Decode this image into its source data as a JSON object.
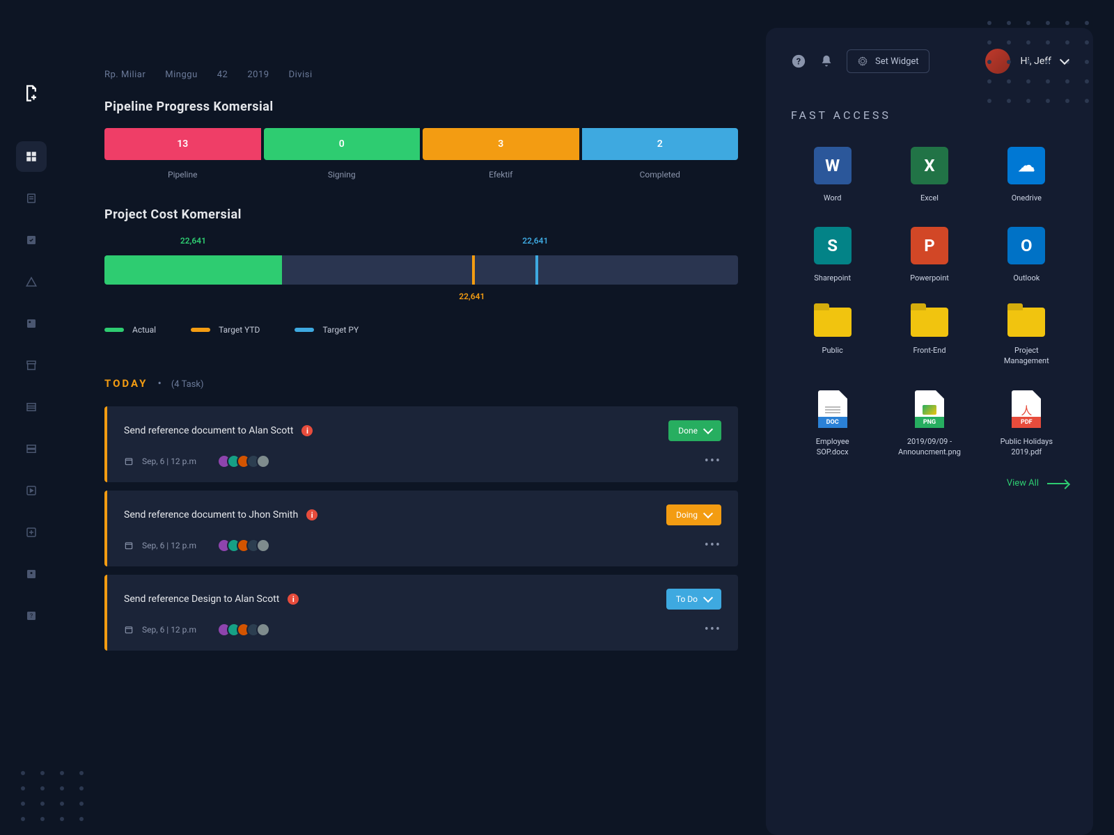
{
  "breadcrumb": [
    "Rp. Miliar",
    "Minggu",
    "42",
    "2019",
    "Divisi"
  ],
  "sections": {
    "pipeline_title": "Pipeline Progress Komersial",
    "cost_title": "Project Cost Komersial"
  },
  "pipeline": [
    {
      "value": "13",
      "label": "Pipeline",
      "color": "#ef3e67"
    },
    {
      "value": "0",
      "label": "Signing",
      "color": "#2ecc71"
    },
    {
      "value": "3",
      "label": "Efektif",
      "color": "#f39c12"
    },
    {
      "value": "2",
      "label": "Completed",
      "color": "#3ea9e0"
    }
  ],
  "chart_data": {
    "type": "bar",
    "title": "Project Cost Komersial",
    "actual": 22641,
    "target_ytd": 22641,
    "target_py": 22641,
    "actual_pct": 28,
    "ytd_marker_pct": 58,
    "py_marker_pct": 68,
    "legend": [
      {
        "name": "Actual",
        "color": "#2ecc71"
      },
      {
        "name": "Target YTD",
        "color": "#f39c12"
      },
      {
        "name": "Target PY",
        "color": "#3ea9e0"
      }
    ]
  },
  "cost_labels": {
    "top_actual": "22,641",
    "top_py": "22,641",
    "bottom_ytd": "22,641"
  },
  "today": {
    "title": "TODAY",
    "count": "(4 Task)"
  },
  "tasks": [
    {
      "title": "Send reference document to Alan Scott",
      "date": "Sep, 6  |  12 p.m",
      "status": "Done",
      "status_color": "#27ae60"
    },
    {
      "title": "Send reference document to Jhon Smith",
      "date": "Sep, 6  |  12 p.m",
      "status": "Doing",
      "status_color": "#f39c12"
    },
    {
      "title": "Send reference Design to Alan Scott",
      "date": "Sep, 6  |  12 p.m",
      "status": "To Do",
      "status_color": "#3ea9e0"
    }
  ],
  "right": {
    "set_widget": "Set Widget",
    "user_greeting": "Hi, Jeff",
    "fast_access_title": "FAST ACCESS",
    "view_all": "View All"
  },
  "fast_access": [
    {
      "label": "Word",
      "kind": "app",
      "bg": "#2b579a",
      "letter": "W"
    },
    {
      "label": "Excel",
      "kind": "app",
      "bg": "#217346",
      "letter": "X"
    },
    {
      "label": "Onedrive",
      "kind": "app",
      "bg": "#0078d4",
      "letter": "☁"
    },
    {
      "label": "Sharepoint",
      "kind": "app",
      "bg": "#038387",
      "letter": "S"
    },
    {
      "label": "Powerpoint",
      "kind": "app",
      "bg": "#d24726",
      "letter": "P"
    },
    {
      "label": "Outlook",
      "kind": "app",
      "bg": "#0072c6",
      "letter": "O"
    },
    {
      "label": "Public",
      "kind": "folder"
    },
    {
      "label": "Front-End",
      "kind": "folder"
    },
    {
      "label": "Project Management",
      "kind": "folder"
    },
    {
      "label": "Employee SOP.docx",
      "kind": "file",
      "badge": "DOC",
      "badge_bg": "#2b81d6"
    },
    {
      "label": "2019/09/09 - Announcment.png",
      "kind": "file",
      "badge": "PNG",
      "badge_bg": "#27ae60"
    },
    {
      "label": "Public Holidays 2019.pdf",
      "kind": "file",
      "badge": "PDF",
      "badge_bg": "#e74c3c"
    }
  ]
}
